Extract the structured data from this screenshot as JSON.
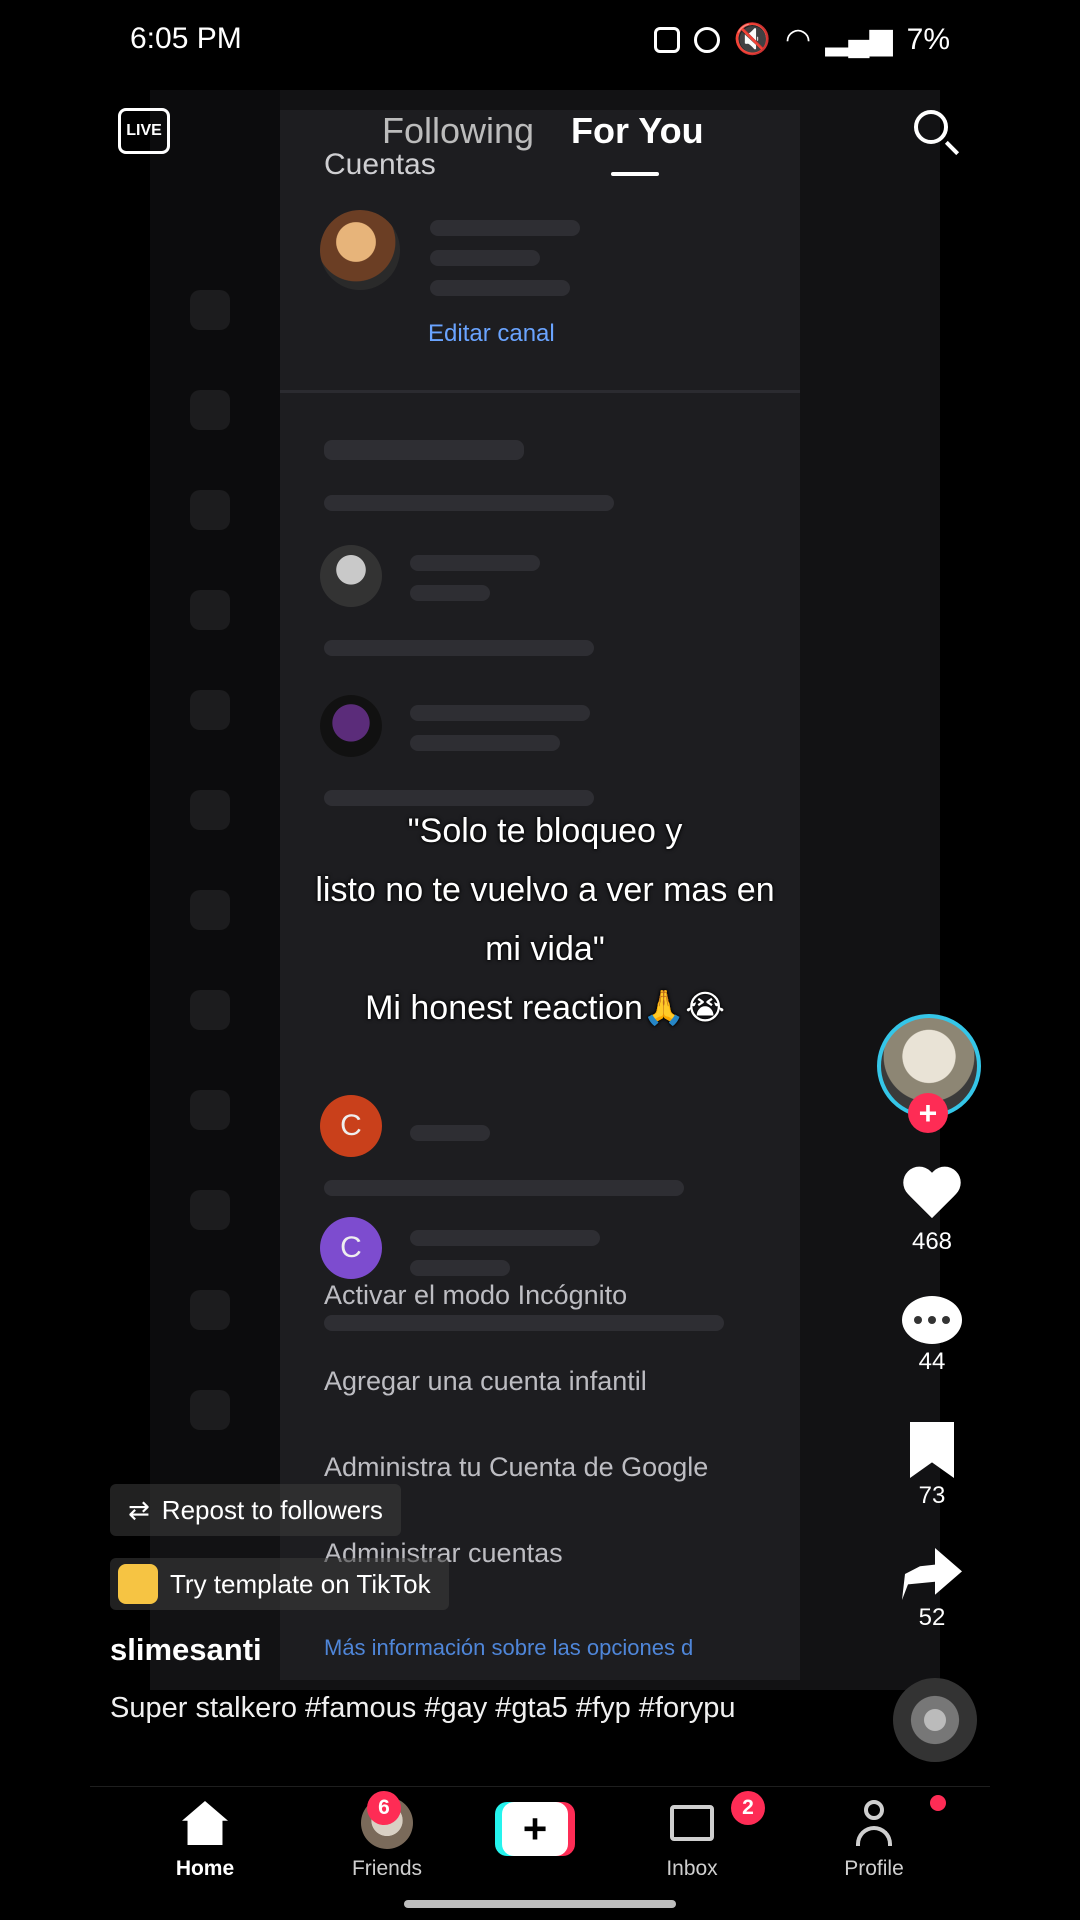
{
  "status_bar": {
    "time": "6:05 PM",
    "battery": "7%",
    "icons": [
      "screenshot-icon",
      "battery-saver-icon",
      "alarm-icon",
      "mute-icon",
      "wifi-icon",
      "signal-icon",
      "battery-icon"
    ]
  },
  "top_nav": {
    "live_label": "LIVE",
    "tabs": [
      {
        "label": "Following"
      },
      {
        "label": "For You"
      }
    ],
    "active_tab": "For You"
  },
  "video": {
    "panel_title": "Cuentas",
    "edit_channel": "Editar canal",
    "menu_items": [
      "Activar el modo Incógnito",
      "Agregar una cuenta infantil",
      "Administra tu Cuenta de Google",
      "Administrar cuentas"
    ],
    "more_info": "Más información sobre las opciones d",
    "account_initials": [
      "C",
      "C"
    ],
    "overlay_caption": "\"Solo te bloqueo y\nlisto no te vuelvo a ver mas en\nmi vida\"\nMi honest reaction🙏😭"
  },
  "actions": {
    "likes": "468",
    "comments": "44",
    "saves": "73",
    "shares": "52"
  },
  "post": {
    "repost_label": "Repost to followers",
    "template_label": "Try template on TikTok",
    "username": "slimesanti",
    "description": "Super stalkero #famous #gay #gta5 #fyp #forypu"
  },
  "bottom_nav": {
    "items": [
      {
        "label": "Home"
      },
      {
        "label": "Friends",
        "badge": "6"
      },
      {
        "label": "+"
      },
      {
        "label": "Inbox",
        "badge": "2"
      },
      {
        "label": "Profile"
      }
    ]
  },
  "colors": {
    "accent_red": "#fe2c55",
    "accent_cyan": "#25f4ee",
    "link_blue": "#6aa4ff"
  }
}
